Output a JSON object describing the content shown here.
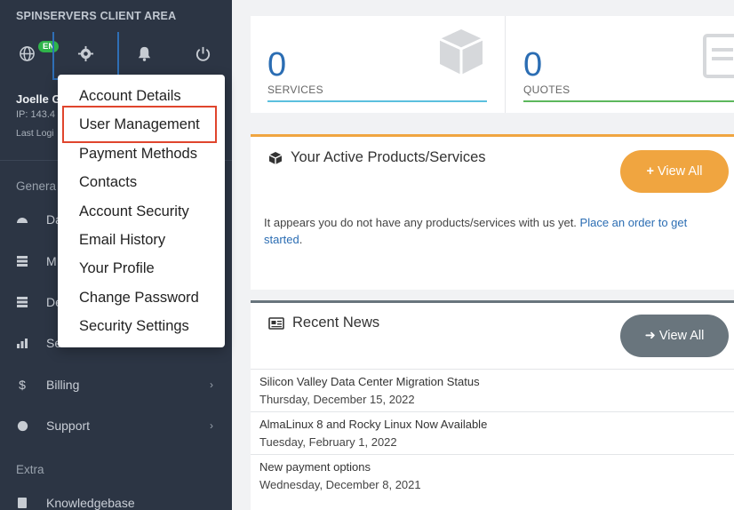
{
  "sidebar": {
    "brand": "SPINSERVERS CLIENT AREA",
    "lang_badge": "EN",
    "user": {
      "name": "Joelle G",
      "ip": "IP: 143.4",
      "last_login": "Last Logi"
    },
    "sections": {
      "general": "Genera",
      "extra": "Extra"
    },
    "items": [
      {
        "label": "Da",
        "icon": "dashboard-icon"
      },
      {
        "label": "M",
        "icon": "list-icon"
      },
      {
        "label": "De",
        "icon": "document-icon"
      },
      {
        "label": "Se",
        "icon": "chart-icon"
      },
      {
        "label": "Billing",
        "icon": "dollar-icon"
      },
      {
        "label": "Support",
        "icon": "support-icon"
      },
      {
        "label": "Knowledgebase",
        "icon": "book-icon"
      }
    ]
  },
  "dropdown": {
    "items": [
      "Account Details",
      "User Management",
      "Payment Methods",
      "Contacts",
      "Account Security",
      "Email History",
      "Your Profile",
      "Change Password",
      "Security Settings"
    ],
    "highlighted": "User Management"
  },
  "stats": [
    {
      "value": "0",
      "label": "SERVICES",
      "color": "#5bc0de"
    },
    {
      "value": "0",
      "label": "QUOTES",
      "color": "#5cb85c"
    }
  ],
  "products": {
    "title": "Your Active Products/Services",
    "button": "View All",
    "empty_text": "It appears you do not have any products/services with us yet.",
    "empty_link": "Place an order to get started",
    "empty_end": "."
  },
  "news": {
    "title": "Recent News",
    "button": "View All",
    "items": [
      {
        "title": "Silicon Valley Data Center Migration Status",
        "date": "Thursday, December 15, 2022"
      },
      {
        "title": "AlmaLinux 8 and Rocky Linux Now Available",
        "date": "Tuesday, February 1, 2022"
      },
      {
        "title": "New payment options",
        "date": "Wednesday, December 8, 2021"
      }
    ]
  },
  "colors": {
    "sidebar": "#2c3544",
    "accent": "#2b6db3",
    "orange": "#f0a540",
    "highlight": "#e0452d"
  }
}
